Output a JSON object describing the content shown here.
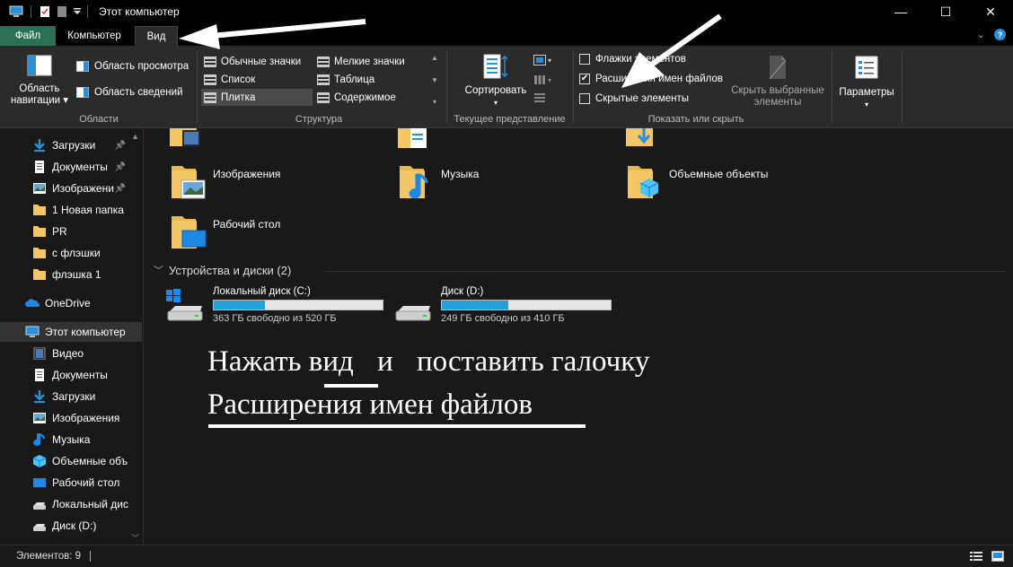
{
  "window": {
    "title": "Этот компьютер",
    "controls": {
      "minimize": "—",
      "maximize": "☐",
      "close": "✕"
    }
  },
  "tabs": {
    "file": "Файл",
    "computer": "Компьютер",
    "view": "Вид"
  },
  "ribbon": {
    "panes": {
      "nav_pane_line1": "Область",
      "nav_pane_line2": "навигации",
      "preview_pane": "Область просмотра",
      "details_pane": "Область сведений",
      "group_label": "Области"
    },
    "layout": {
      "items": [
        "Обычные значки",
        "Мелкие значки",
        "Список",
        "Таблица",
        "Плитка",
        "Содержимое"
      ],
      "selected": "Плитка",
      "group_label": "Структура"
    },
    "current_view": {
      "sort_label": "Сортировать",
      "group_label": "Текущее представление"
    },
    "show_hide": {
      "item_checkboxes": "Флажки элементов",
      "file_extensions": "Расширения имен файлов",
      "hidden_items": "Скрытые элементы",
      "hide_selected_line1": "Скрыть выбранные",
      "hide_selected_line2": "элементы",
      "group_label": "Показать или скрыть",
      "checked": {
        "item_checkboxes": false,
        "file_extensions": true,
        "hidden_items": false
      }
    },
    "options_label": "Параметры"
  },
  "sidebar": {
    "quick_access": [
      {
        "label": "Загрузки",
        "icon": "download-icon",
        "pinned": true
      },
      {
        "label": "Документы",
        "icon": "document-icon",
        "pinned": true
      },
      {
        "label": "Изображени",
        "icon": "image-icon",
        "pinned": true
      },
      {
        "label": "1 Новая папка",
        "icon": "folder-icon",
        "pinned": false
      },
      {
        "label": "PR",
        "icon": "folder-icon",
        "pinned": false
      },
      {
        "label": "с флэшки",
        "icon": "folder-icon",
        "pinned": false
      },
      {
        "label": "флэшка 1",
        "icon": "folder-icon",
        "pinned": false
      }
    ],
    "onedrive": "OneDrive",
    "this_pc": "Этот компьютер",
    "this_pc_items": [
      {
        "label": "Видео",
        "icon": "video-icon"
      },
      {
        "label": "Документы",
        "icon": "document-icon"
      },
      {
        "label": "Загрузки",
        "icon": "download-icon"
      },
      {
        "label": "Изображения",
        "icon": "image-icon"
      },
      {
        "label": "Музыка",
        "icon": "music-icon"
      },
      {
        "label": "Объемные объ",
        "icon": "cube-icon"
      },
      {
        "label": "Рабочий стол",
        "icon": "desktop-icon"
      },
      {
        "label": "Локальный дис",
        "icon": "drive-icon"
      },
      {
        "label": "Диск (D:)",
        "icon": "drive-icon"
      }
    ]
  },
  "content": {
    "folders": [
      {
        "label": "Изображения",
        "icon": "image-icon"
      },
      {
        "label": "Музыка",
        "icon": "music-icon"
      },
      {
        "label": "Объемные объекты",
        "icon": "cube-icon"
      },
      {
        "label": "Рабочий стол",
        "icon": "desktop-icon"
      }
    ],
    "devices_header": "Устройства и диски (2)",
    "drives": [
      {
        "name": "Локальный диск (C:)",
        "free": "363 ГБ свободно из 520 ГБ",
        "used_fraction": 0.302
      },
      {
        "name": "Диск (D:)",
        "free": "249 ГБ свободно из 410 ГБ",
        "used_fraction": 0.393
      }
    ],
    "annotation": {
      "line1_a": "Нажать",
      "line1_b": "вид",
      "line1_c": "и",
      "line1_d": "поставить галочку",
      "line2": "Расширения имен файлов"
    }
  },
  "statusbar": {
    "count": "Элементов: 9"
  },
  "colors": {
    "accent": "#26a0da",
    "file_tab": "#2b6f55",
    "folder": "#f3c766"
  }
}
